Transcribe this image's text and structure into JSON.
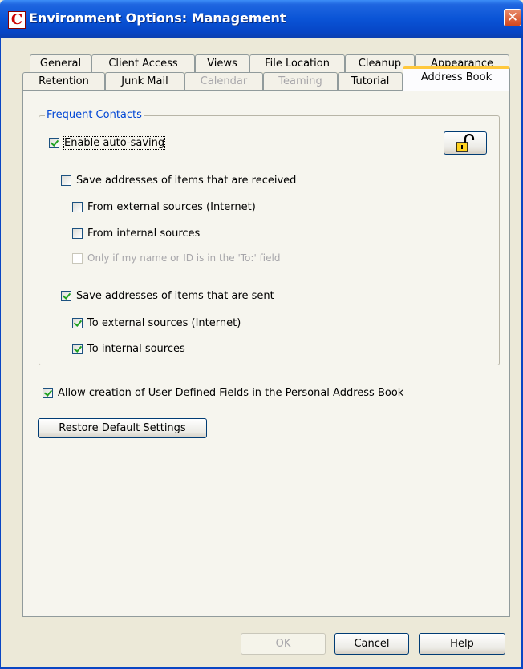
{
  "window": {
    "title": "Environment Options:  Management",
    "app_icon_letter": "C",
    "close_glyph": "✕"
  },
  "tabs_row1": [
    {
      "label": "General"
    },
    {
      "label": "Client Access"
    },
    {
      "label": "Views"
    },
    {
      "label": "File Location"
    },
    {
      "label": "Cleanup"
    },
    {
      "label": "Appearance"
    }
  ],
  "tabs_row2": [
    {
      "label": "Retention",
      "disabled": false
    },
    {
      "label": "Junk Mail",
      "disabled": false
    },
    {
      "label": "Calendar",
      "disabled": true
    },
    {
      "label": "Teaming",
      "disabled": true
    },
    {
      "label": "Tutorial",
      "disabled": false
    },
    {
      "label": "Address Book",
      "active": true
    }
  ],
  "frequent_contacts": {
    "title": "Frequent Contacts",
    "enable_auto_saving": {
      "label": "Enable auto-saving",
      "checked": true
    },
    "lock_icon": "unlocked-padlock-icon",
    "received": {
      "label": "Save addresses of items that are received",
      "checked": false
    },
    "received_external": {
      "label": "From external sources (Internet)",
      "checked": false
    },
    "received_internal": {
      "label": "From internal sources",
      "checked": false
    },
    "only_if_name": {
      "label": "Only if my name or ID is in the 'To:' field",
      "checked": false,
      "disabled": true
    },
    "sent": {
      "label": "Save addresses of items that are sent",
      "checked": true
    },
    "sent_external": {
      "label": "To external sources (Internet)",
      "checked": true
    },
    "sent_internal": {
      "label": "To internal sources",
      "checked": true
    }
  },
  "allow_user_fields": {
    "label": "Allow creation of User Defined Fields in the Personal Address Book",
    "checked": true
  },
  "restore_button": "Restore Default Settings",
  "footer": {
    "ok": "OK",
    "cancel": "Cancel",
    "help": "Help"
  }
}
